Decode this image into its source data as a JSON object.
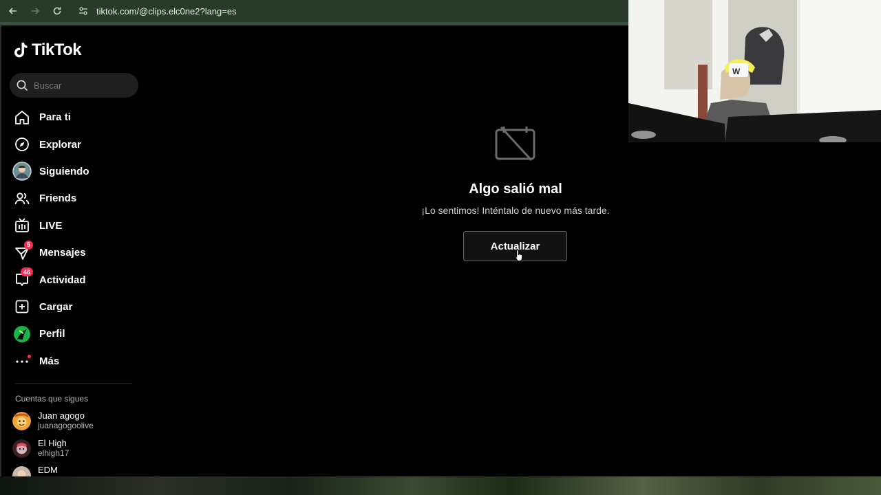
{
  "browser": {
    "url": "tiktok.com/@clips.elc0ne2?lang=es"
  },
  "brand": {
    "name": "TikTok"
  },
  "search": {
    "placeholder": "Buscar"
  },
  "nav": [
    {
      "label": "Para ti",
      "icon": "home-icon"
    },
    {
      "label": "Explorar",
      "icon": "compass-icon"
    },
    {
      "label": "Siguiendo",
      "icon": "avatar"
    },
    {
      "label": "Friends",
      "icon": "friends-icon"
    },
    {
      "label": "LIVE",
      "icon": "live-tv-icon"
    },
    {
      "label": "Mensajes",
      "icon": "send-icon",
      "badge": "5"
    },
    {
      "label": "Actividad",
      "icon": "inbox-icon",
      "badge": "46"
    },
    {
      "label": "Cargar",
      "icon": "upload-plus-icon"
    },
    {
      "label": "Perfil",
      "icon": "profile-avatar"
    },
    {
      "label": "Más",
      "icon": "more-icon"
    }
  ],
  "following": {
    "title": "Cuentas que sigues",
    "accounts": [
      {
        "name": "Juan agogo",
        "username": "juanagogoolive"
      },
      {
        "name": "El High",
        "username": "elhigh17"
      },
      {
        "name": "EDM",
        "username": ""
      }
    ]
  },
  "error": {
    "title": "Algo salió mal",
    "message": "¡Lo sentimos! Inténtalo de nuevo más tarde.",
    "button": "Actualizar"
  },
  "colors": {
    "accent": "#fe2c55",
    "background": "#000000"
  }
}
